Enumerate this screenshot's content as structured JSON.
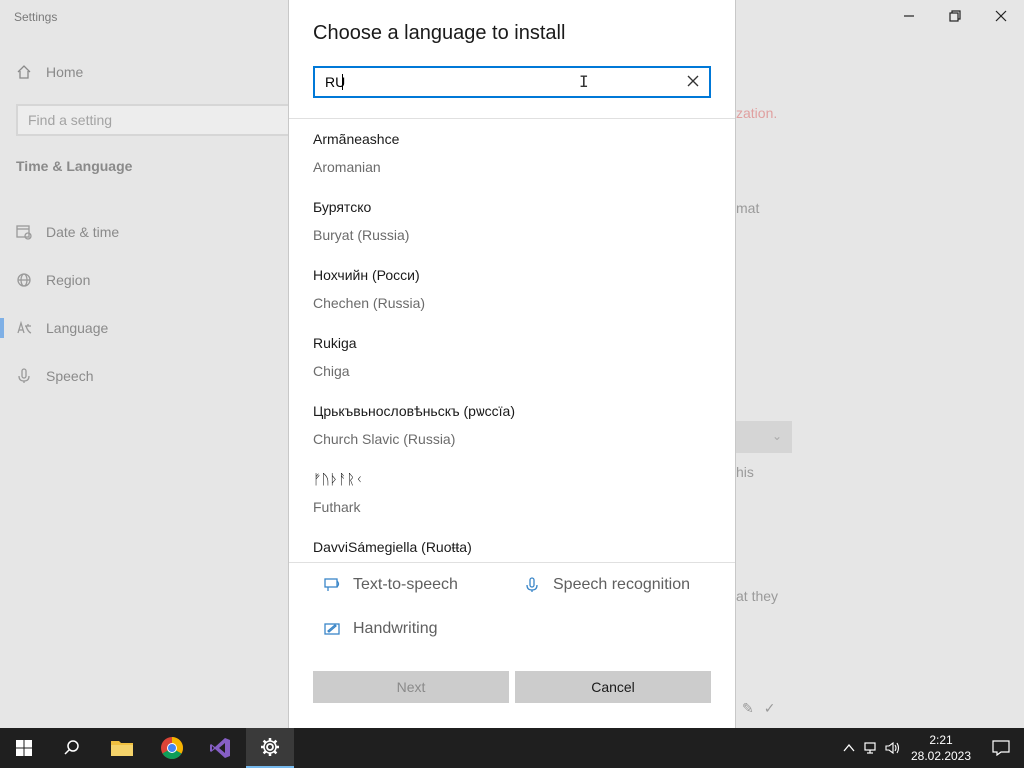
{
  "settings": {
    "app_title": "Settings",
    "home_label": "Home",
    "find_placeholder": "Find a setting",
    "section_title": "Time & Language",
    "nav_items": [
      {
        "label": "Date & time"
      },
      {
        "label": "Region"
      },
      {
        "label": "Language"
      },
      {
        "label": "Speech"
      }
    ],
    "bg_text": {
      "zation": "zation.",
      "mat": "mat",
      "his": "his",
      "at_they": "at they"
    }
  },
  "dialog": {
    "title": "Choose a language to install",
    "search_value": "RU",
    "languages": [
      {
        "native": "Armãneashce",
        "english": "Aromanian"
      },
      {
        "native": "Бурятско",
        "english": "Buryat (Russia)"
      },
      {
        "native": "Нохчийн (Росси)",
        "english": "Chechen (Russia)"
      },
      {
        "native": "Rukiga",
        "english": "Chiga"
      },
      {
        "native": "Црькъвьнословѣньскъ (рѡссїа)",
        "english": "Church Slavic (Russia)"
      },
      {
        "native": "ᚠᚢᚦᚨᚱᚲ",
        "english": "Futhark"
      },
      {
        "native": "DavviSámegiella (Ruoŧŧa)",
        "english": ""
      }
    ],
    "features": {
      "tts": "Text-to-speech",
      "speech": "Speech recognition",
      "handwriting": "Handwriting"
    },
    "next_label": "Next",
    "cancel_label": "Cancel"
  },
  "taskbar": {
    "time": "2:21",
    "date": "28.02.2023"
  },
  "colors": {
    "accent": "#0078d7",
    "feature_icon": "#3a86c8",
    "taskbar": "#1f1f1f"
  }
}
